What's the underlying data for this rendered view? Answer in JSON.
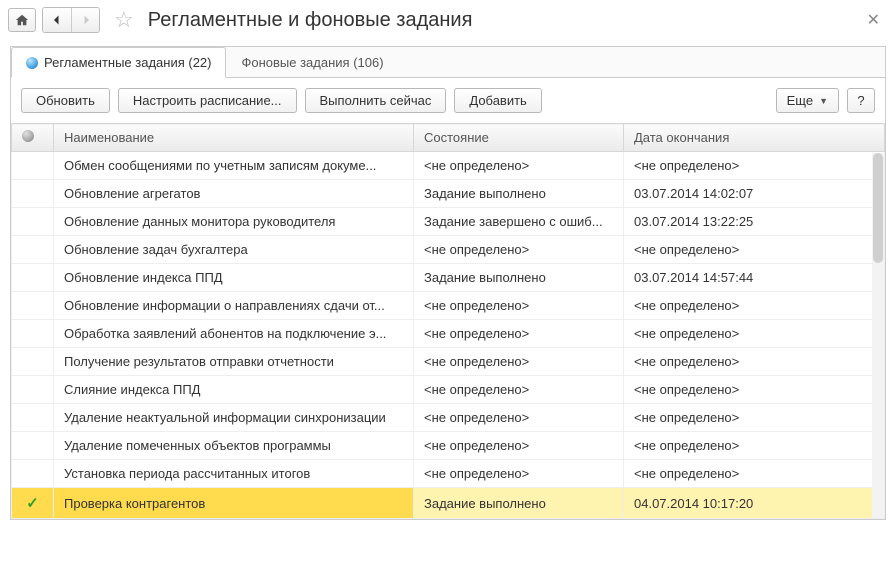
{
  "header": {
    "title": "Регламентные и фоновые задания"
  },
  "tabs": [
    {
      "label": "Регламентные задания (22)",
      "active": true
    },
    {
      "label": "Фоновые задания (106)",
      "active": false
    }
  ],
  "toolbar": {
    "refresh": "Обновить",
    "schedule": "Настроить расписание...",
    "run_now": "Выполнить сейчас",
    "add": "Добавить",
    "more": "Еще",
    "help": "?"
  },
  "table": {
    "columns": {
      "name": "Наименование",
      "state": "Состояние",
      "end_date": "Дата окончания"
    },
    "undefined_text": "<не определено>",
    "rows": [
      {
        "check": false,
        "name": "Обмен сообщениями по учетным записям докуме...",
        "state_undef": true,
        "state": "",
        "end_undef": true,
        "end": "",
        "selected": false
      },
      {
        "check": false,
        "name": "Обновление агрегатов",
        "state_undef": false,
        "state": "Задание выполнено",
        "end_undef": false,
        "end": "03.07.2014 14:02:07",
        "selected": false
      },
      {
        "check": false,
        "name": "Обновление данных монитора руководителя",
        "state_undef": false,
        "state": "Задание завершено с ошиб...",
        "end_undef": false,
        "end": "03.07.2014 13:22:25",
        "selected": false
      },
      {
        "check": false,
        "name": "Обновление задач бухгалтера",
        "state_undef": true,
        "state": "",
        "end_undef": true,
        "end": "",
        "selected": false
      },
      {
        "check": false,
        "name": "Обновление индекса ППД",
        "state_undef": false,
        "state": "Задание выполнено",
        "end_undef": false,
        "end": "03.07.2014 14:57:44",
        "selected": false
      },
      {
        "check": false,
        "name": "Обновление информации о направлениях сдачи от...",
        "state_undef": true,
        "state": "",
        "end_undef": true,
        "end": "",
        "selected": false
      },
      {
        "check": false,
        "name": "Обработка заявлений абонентов на подключение э...",
        "state_undef": true,
        "state": "",
        "end_undef": true,
        "end": "",
        "selected": false
      },
      {
        "check": false,
        "name": "Получение результатов отправки отчетности",
        "state_undef": true,
        "state": "",
        "end_undef": true,
        "end": "",
        "selected": false
      },
      {
        "check": false,
        "name": "Слияние индекса ППД",
        "state_undef": true,
        "state": "",
        "end_undef": true,
        "end": "",
        "selected": false
      },
      {
        "check": false,
        "name": "Удаление неактуальной информации синхронизации",
        "state_undef": true,
        "state": "",
        "end_undef": true,
        "end": "",
        "selected": false
      },
      {
        "check": false,
        "name": "Удаление помеченных объектов программы",
        "state_undef": true,
        "state": "",
        "end_undef": true,
        "end": "",
        "selected": false
      },
      {
        "check": false,
        "name": "Установка периода рассчитанных итогов",
        "state_undef": true,
        "state": "",
        "end_undef": true,
        "end": "",
        "selected": false
      },
      {
        "check": true,
        "name": "Проверка контрагентов",
        "state_undef": false,
        "state": "Задание выполнено",
        "end_undef": false,
        "end": "04.07.2014 10:17:20",
        "selected": true
      }
    ]
  }
}
